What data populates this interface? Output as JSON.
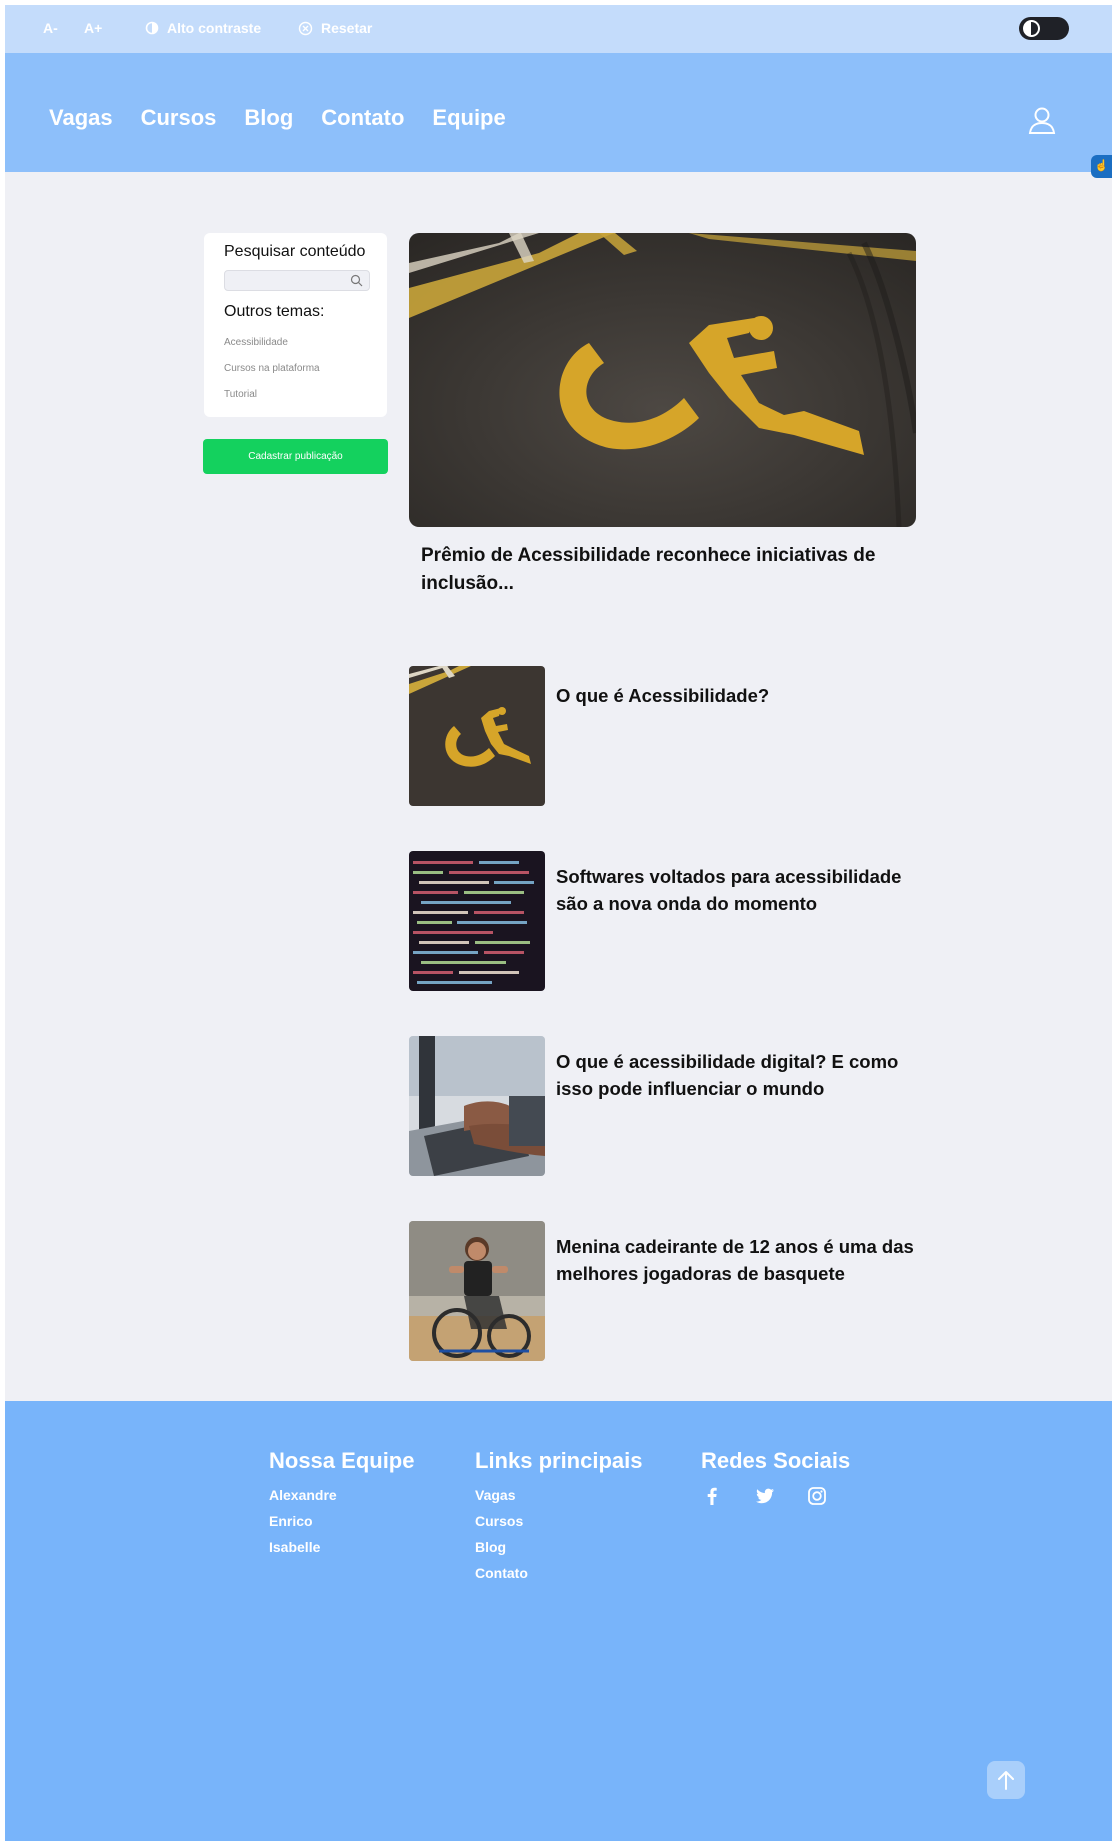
{
  "a11y_bar": {
    "decrease_font": "A-",
    "increase_font": "A+",
    "high_contrast": "Alto contraste",
    "reset": "Resetar"
  },
  "nav": {
    "items": [
      "Vagas",
      "Cursos",
      "Blog",
      "Contato",
      "Equipe"
    ]
  },
  "sidebar": {
    "search_title": "Pesquisar conteúdo",
    "search_placeholder": "",
    "topics_title": "Outros temas:",
    "topics": [
      "Acessibilidade",
      "Cursos na plataforma",
      "Tutorial"
    ],
    "publish_button": "Cadastrar publicação"
  },
  "featured": {
    "title": "Prêmio de Acessibilidade reconhece iniciativas de inclusão..."
  },
  "articles": [
    {
      "title": "O que é Acessibilidade?"
    },
    {
      "title": "Softwares voltados para acessibilidade são a nova onda do momento"
    },
    {
      "title": "O que é acessibilidade digital? E como isso pode influenciar o mundo"
    },
    {
      "title": "Menina cadeirante de 12 anos é uma das melhores jogadoras de basquete"
    }
  ],
  "footer": {
    "team_title": "Nossa Equipe",
    "team": [
      "Alexandre",
      "Enrico",
      "Isabelle"
    ],
    "links_title": "Links principais",
    "links": [
      "Vagas",
      "Cursos",
      "Blog",
      "Contato"
    ],
    "social_title": "Redes Sociais",
    "social_icons": [
      "facebook-icon",
      "twitter-icon",
      "instagram-icon"
    ]
  },
  "colors": {
    "a11y_bar": "#c4dcfb",
    "header": "#8dbffa",
    "page_bg": "#eff0f5",
    "footer": "#78b4fa",
    "publish_button": "#14d15e"
  }
}
